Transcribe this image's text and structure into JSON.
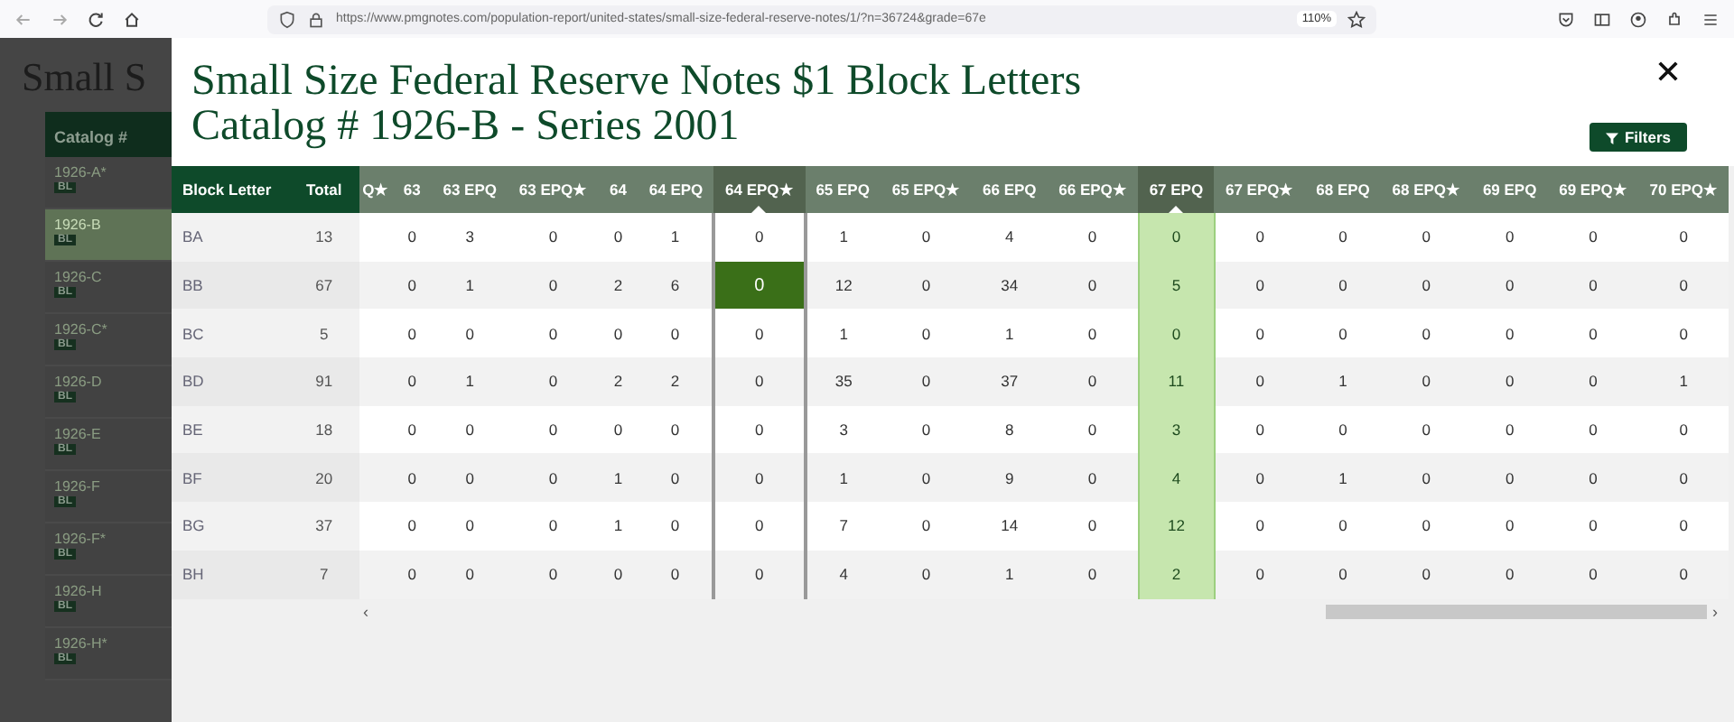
{
  "browser": {
    "url": "https://www.pmgnotes.com/population-report/united-states/small-size-federal-reserve-notes/1/?n=36724&grade=67e",
    "zoom": "110%"
  },
  "background": {
    "title": "Small S",
    "sidebar_header": "Catalog #",
    "items": [
      {
        "label": "1926-A*",
        "badge": "BL",
        "selected": false
      },
      {
        "label": "1926-B",
        "badge": "BL",
        "selected": true
      },
      {
        "label": "1926-C",
        "badge": "BL",
        "selected": false
      },
      {
        "label": "1926-C*",
        "badge": "BL",
        "selected": false
      },
      {
        "label": "1926-D",
        "badge": "BL",
        "selected": false
      },
      {
        "label": "1926-E",
        "badge": "BL",
        "selected": false
      },
      {
        "label": "1926-F",
        "badge": "BL",
        "selected": false
      },
      {
        "label": "1926-F*",
        "badge": "BL",
        "selected": false
      },
      {
        "label": "1926-H",
        "badge": "BL",
        "selected": false
      },
      {
        "label": "1926-H*",
        "badge": "BL",
        "selected": false
      }
    ]
  },
  "modal": {
    "title_line_1": "Small Size Federal Reserve Notes $1 Block Letters",
    "title_line_2": "Catalog # 1926-B - Series 2001",
    "filters_button": "Filters",
    "table": {
      "frozen_columns": [
        "Block Letter",
        "Total"
      ],
      "partial_column": "Q★",
      "columns": [
        {
          "label": "63",
          "selected": false,
          "highlighted": false
        },
        {
          "label": "63 EPQ",
          "selected": false,
          "highlighted": false
        },
        {
          "label": "63 EPQ★",
          "selected": false,
          "highlighted": false
        },
        {
          "label": "64",
          "selected": false,
          "highlighted": false
        },
        {
          "label": "64 EPQ",
          "selected": false,
          "highlighted": false
        },
        {
          "label": "64 EPQ★",
          "selected": true,
          "highlighted": false
        },
        {
          "label": "65 EPQ",
          "selected": false,
          "highlighted": false
        },
        {
          "label": "65 EPQ★",
          "selected": false,
          "highlighted": false
        },
        {
          "label": "66 EPQ",
          "selected": false,
          "highlighted": false
        },
        {
          "label": "66 EPQ★",
          "selected": false,
          "highlighted": false
        },
        {
          "label": "67 EPQ",
          "selected": false,
          "highlighted": true
        },
        {
          "label": "67 EPQ★",
          "selected": false,
          "highlighted": false
        },
        {
          "label": "68 EPQ",
          "selected": false,
          "highlighted": false
        },
        {
          "label": "68 EPQ★",
          "selected": false,
          "highlighted": false
        },
        {
          "label": "69 EPQ",
          "selected": false,
          "highlighted": false
        },
        {
          "label": "69 EPQ★",
          "selected": false,
          "highlighted": false
        },
        {
          "label": "70 EPQ★",
          "selected": false,
          "highlighted": false
        }
      ],
      "rows": [
        {
          "block": "BA",
          "total": "13",
          "selected": false,
          "cells": [
            "0",
            "3",
            "0",
            "0",
            "1",
            "0",
            "1",
            "0",
            "4",
            "0",
            "0",
            "0",
            "0",
            "0",
            "0",
            "0",
            "0"
          ]
        },
        {
          "block": "BB",
          "total": "67",
          "selected": true,
          "cells": [
            "0",
            "1",
            "0",
            "2",
            "6",
            "0",
            "12",
            "0",
            "34",
            "0",
            "5",
            "0",
            "0",
            "0",
            "0",
            "0",
            "0"
          ]
        },
        {
          "block": "BC",
          "total": "5",
          "selected": false,
          "cells": [
            "0",
            "0",
            "0",
            "0",
            "0",
            "0",
            "1",
            "0",
            "1",
            "0",
            "0",
            "0",
            "0",
            "0",
            "0",
            "0",
            "0"
          ]
        },
        {
          "block": "BD",
          "total": "91",
          "selected": false,
          "cells": [
            "0",
            "1",
            "0",
            "2",
            "2",
            "0",
            "35",
            "0",
            "37",
            "0",
            "11",
            "0",
            "1",
            "0",
            "0",
            "0",
            "1"
          ]
        },
        {
          "block": "BE",
          "total": "18",
          "selected": false,
          "cells": [
            "0",
            "0",
            "0",
            "0",
            "0",
            "0",
            "3",
            "0",
            "8",
            "0",
            "3",
            "0",
            "0",
            "0",
            "0",
            "0",
            "0"
          ]
        },
        {
          "block": "BF",
          "total": "20",
          "selected": false,
          "cells": [
            "0",
            "0",
            "0",
            "1",
            "0",
            "0",
            "1",
            "0",
            "9",
            "0",
            "4",
            "0",
            "1",
            "0",
            "0",
            "0",
            "0"
          ]
        },
        {
          "block": "BG",
          "total": "37",
          "selected": false,
          "cells": [
            "0",
            "0",
            "0",
            "1",
            "0",
            "0",
            "7",
            "0",
            "14",
            "0",
            "12",
            "0",
            "0",
            "0",
            "0",
            "0",
            "0"
          ]
        },
        {
          "block": "BH",
          "total": "7",
          "selected": false,
          "cells": [
            "0",
            "0",
            "0",
            "0",
            "0",
            "0",
            "4",
            "0",
            "1",
            "0",
            "2",
            "0",
            "0",
            "0",
            "0",
            "0",
            "0"
          ]
        }
      ],
      "scroll_left": "‹",
      "scroll_right": "›"
    }
  }
}
